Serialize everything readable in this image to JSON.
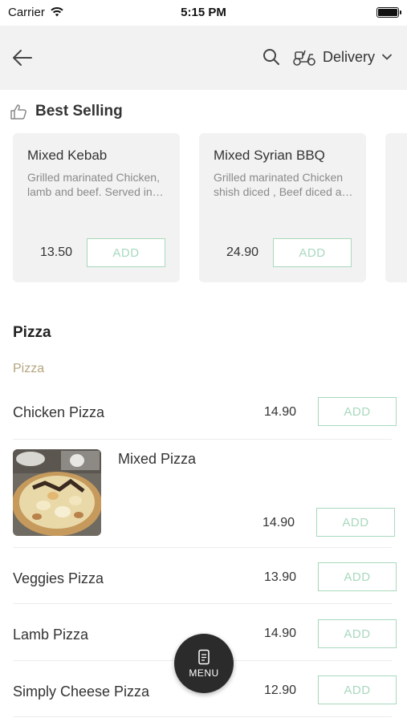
{
  "status": {
    "carrier": "Carrier",
    "time": "5:15 PM"
  },
  "header": {
    "delivery_label": "Delivery"
  },
  "best_selling": {
    "title": "Best Selling",
    "items": [
      {
        "name": "Mixed Kebab",
        "desc": "Grilled marinated Chicken, lamb and beef. Served in…",
        "price": "13.50",
        "add": "ADD"
      },
      {
        "name": "Mixed Syrian BBQ",
        "desc": "Grilled marinated Chicken shish diced , Beef diced a…",
        "price": "24.90",
        "add": "ADD"
      }
    ]
  },
  "pizza": {
    "title": "Pizza",
    "subtitle": "Pizza",
    "items": [
      {
        "name": "Chicken Pizza",
        "price": "14.90",
        "add": "ADD"
      },
      {
        "name": "Mixed Pizza",
        "price": "14.90",
        "add": "ADD"
      },
      {
        "name": "Veggies Pizza",
        "price": "13.90",
        "add": "ADD"
      },
      {
        "name": "Lamb Pizza",
        "price": "14.90",
        "add": "ADD"
      },
      {
        "name": "Simply Cheese Pizza",
        "price": "12.90",
        "add": "ADD"
      }
    ]
  },
  "menu_button": {
    "label": "MENU"
  },
  "colors": {
    "accent_green": "#a8d8bd",
    "header_bg": "#f2f2f2",
    "subtitle_gold": "#b3a57f",
    "fab_bg": "#2b2b2b"
  },
  "icons": [
    "wifi-icon",
    "battery-icon",
    "back-arrow-icon",
    "search-icon",
    "scooter-icon",
    "chevron-down-icon",
    "thumbs-up-icon",
    "menu-icon"
  ]
}
